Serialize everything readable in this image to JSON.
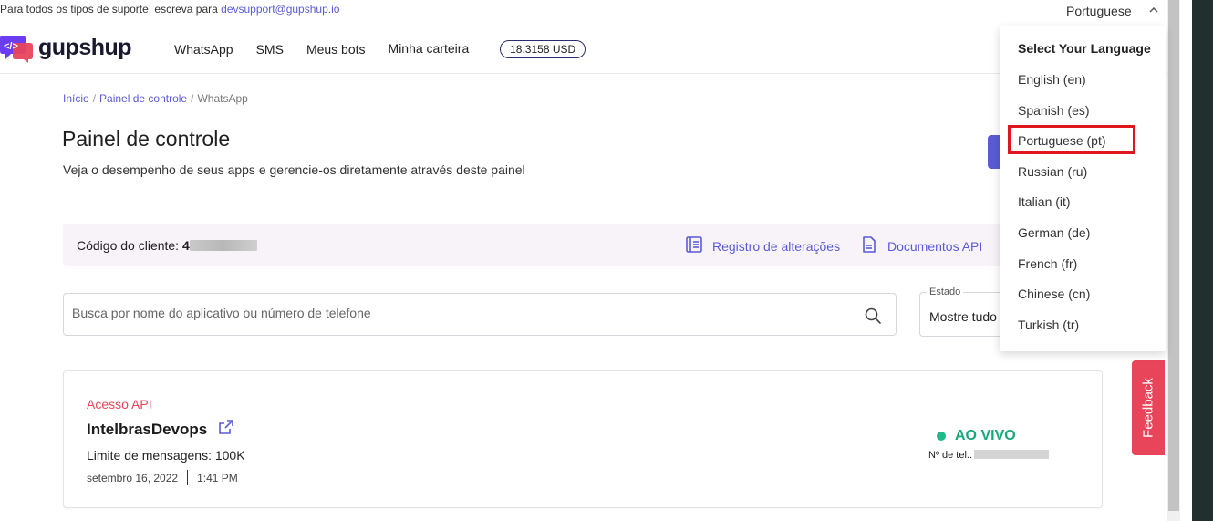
{
  "support": {
    "text": "Para todos os tipos de suporte, escreva para",
    "email": "devsupport@gupshup.io"
  },
  "language_toggle": {
    "current": "Portuguese",
    "icon": "chevron-up-icon"
  },
  "brand": {
    "name": "gupshup",
    "logo_glyph": "</>",
    "logo_colors": [
      "#6a3df0",
      "#e8455a"
    ]
  },
  "nav": {
    "items": [
      "WhatsApp",
      "SMS",
      "Meus bots",
      "Minha carteira"
    ],
    "wallet_balance": "18.3158 USD"
  },
  "breadcrumb": {
    "items": [
      "Início",
      "Painel de controle",
      "WhatsApp"
    ],
    "separator": "/"
  },
  "page": {
    "title": "Painel de controle",
    "subtitle": "Veja o desempenho de seus apps e gerencie-os diretamente através deste painel"
  },
  "client": {
    "label": "Código do cliente:",
    "code_visible": "4",
    "changelog_label": "Registro de alterações",
    "changelog_icon": "list-document-icon",
    "api_docs_label": "Documentos API",
    "api_docs_icon": "document-icon"
  },
  "search": {
    "placeholder": "Busca por nome do aplicativo ou número de telefone",
    "value": "",
    "icon": "search-icon"
  },
  "state_filter": {
    "label": "Estado",
    "value": "Mostre tudo"
  },
  "app_card": {
    "tag": "Acesso API",
    "name": "IntelbrasDevops",
    "external_icon": "external-link-icon",
    "message_limit": "Limite de mensagens: 100K",
    "date": "setembro 16, 2022",
    "time": "1:41 PM",
    "status": "AO VIVO",
    "phone_label": "Nº de tel.:"
  },
  "feedback": {
    "label": "Feedback"
  },
  "language_menu": {
    "heading": "Select Your Language",
    "options": [
      "English (en)",
      "Spanish (es)",
      "Portuguese (pt)",
      "Russian (ru)",
      "Italian (it)",
      "German (de)",
      "French (fr)",
      "Chinese (cn)",
      "Turkish (tr)"
    ],
    "highlighted": "Portuguese (pt)"
  },
  "colors": {
    "accent": "#5b5bd6",
    "live": "#1aa87a",
    "api_tag": "#e8455a",
    "highlight_box": "#e0161f",
    "feedback": "#e8455a"
  }
}
